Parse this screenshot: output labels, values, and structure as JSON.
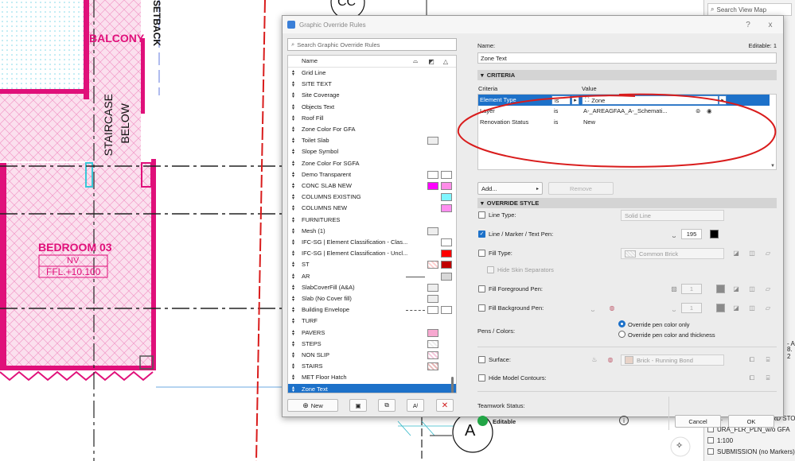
{
  "colors": {
    "accent": "#1d71c9",
    "cad_magenta": "#e0107a",
    "annotation_red": "#d91c1c",
    "editable_green": "#22a546"
  },
  "cad": {
    "labels": {
      "balcony": "BALCONY",
      "setback": "SETBACK",
      "staircase": "STAIRCASE",
      "below": "BELOW",
      "bedroom": "BEDROOM 03",
      "nv": "NV",
      "ffl": "FFL.+10.100",
      "grid_top": "CC",
      "grid_a": "A"
    }
  },
  "navigator": {
    "search_placeholder": "Search View Map",
    "rows": [
      "Z.",
      "URA_FLR_PLN_w/o GFA",
      "1:100",
      "SUBMISSION (no Markers)"
    ],
    "row0_right": "3RD STO",
    "side_a": "- A",
    "side_b": "8. 2"
  },
  "dialog": {
    "title": "Graphic Override Rules",
    "help_icon": "?",
    "close_icon": "x",
    "search_placeholder": "Search Graphic Override Rules",
    "list_header": "Name",
    "rules": [
      "Grid Line",
      "SITE TEXT",
      "Site Coverage",
      "Objects Text",
      "Roof Fill",
      "Zone Color For GFA",
      "Toilet Slab",
      "Slope Symbol",
      "Zone Color For SGFA",
      "Demo Transparent",
      "CONC SLAB NEW",
      "COLUMNS EXISTING",
      "COLUMNS NEW",
      "FURNITURES",
      "Mesh (1)",
      "IFC-SG | Element Classification - Clas...",
      "IFC-SG | Element Classification - Uncl...",
      "ST",
      "AR",
      "SlabCoverFill (A&A)",
      "Slab (No Cover fill)",
      "Building Envelope",
      "TURF",
      "PAVERS",
      "STEPS",
      "NON SLIP",
      "STAIRS",
      "MET Floor Hatch",
      "Zone Text"
    ],
    "selected_rule": "Zone Text",
    "new_label": "New",
    "name_label": "Name:",
    "editable_label": "Editable: 1",
    "name_value": "Zone Text",
    "criteria": {
      "section": "CRITERIA",
      "col_criteria": "Criteria",
      "col_value": "Value",
      "rows": [
        {
          "criteria": "Element Type",
          "op": "is",
          "value": "Zone"
        },
        {
          "criteria": "Layer",
          "op": "is",
          "value": "A-_AREAGFAA_A-_Schemati..."
        },
        {
          "criteria": "Renovation Status",
          "op": "is",
          "value": "New"
        }
      ],
      "add_label": "Add...",
      "remove_label": "Remove"
    },
    "override": {
      "section": "OVERRIDE STYLE",
      "line_type": {
        "label": "Line Type:",
        "value": "Solid Line",
        "checked": false
      },
      "line_pen": {
        "label": "Line / Marker / Text Pen:",
        "value": "195",
        "checked": true
      },
      "fill_type": {
        "label": "Fill Type:",
        "value": "Common Brick",
        "checked": false
      },
      "hide_skin": "Hide Skin Separators",
      "fill_fg": {
        "label": "Fill Foreground Pen:",
        "value": "1",
        "checked": false
      },
      "fill_bg": {
        "label": "Fill Background Pen:",
        "value": "1",
        "checked": false
      },
      "pens_colors": "Pens / Colors:",
      "radio_1": "Override pen color only",
      "radio_2": "Override pen color and thickness",
      "surface": {
        "label": "Surface:",
        "value": "Brick - Running Bond",
        "checked": false
      },
      "hide_contours": "Hide Model Contours:"
    },
    "teamwork_label": "Teamwork Status:",
    "teamwork_value": "Editable",
    "cancel_label": "Cancel",
    "ok_label": "OK"
  }
}
